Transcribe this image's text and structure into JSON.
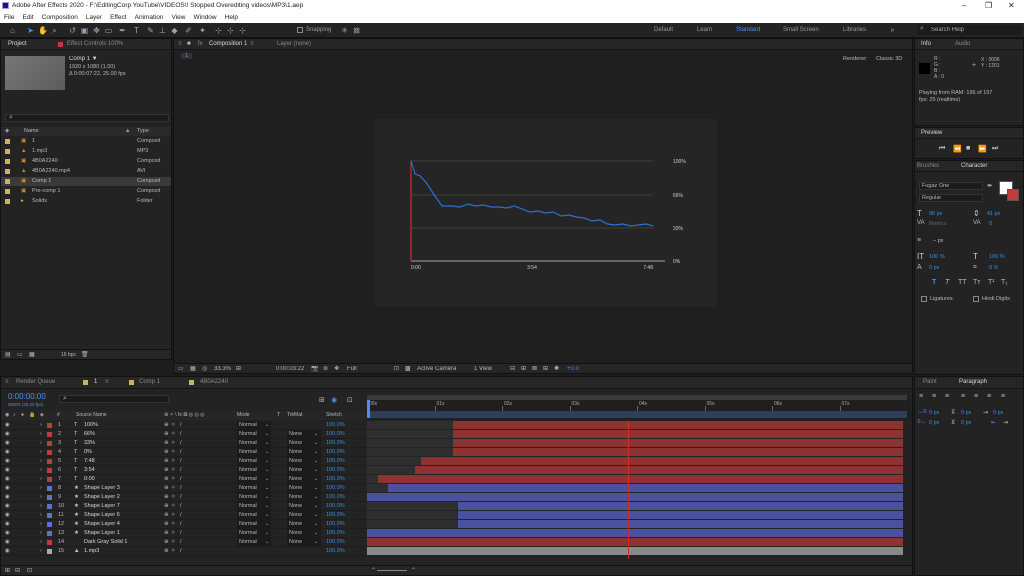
{
  "window": {
    "title": "Adobe After Effects 2020 - F:\\EditingCorp YouTube\\VIDEOS\\! Stopped Overediting videos\\MP3\\1.aep",
    "controls": [
      "–",
      "❐",
      "✕"
    ]
  },
  "menu": [
    "File",
    "Edit",
    "Composition",
    "Layer",
    "Effect",
    "Animation",
    "View",
    "Window",
    "Help"
  ],
  "toolbar": {
    "snapping": "Snapping",
    "workspaces": [
      "Default",
      "Learn",
      "Standard",
      "Small Screen",
      "Libraries"
    ],
    "active_workspace": "Standard",
    "search_help": "Search Help"
  },
  "project": {
    "tabs": [
      "Project",
      "Effect Controls 100%"
    ],
    "comp_name": "Comp 1 ▼",
    "comp_info": [
      "1920 x 1080 (1.00)",
      "Δ 0:00:07:22, 25.00 fps"
    ],
    "col_name": "Name",
    "col_type": "Type",
    "items": [
      {
        "name": "1",
        "type": "Composit",
        "color": "#c7b36b"
      },
      {
        "name": "1.mp3",
        "type": "MP3",
        "color": "#c7b36b"
      },
      {
        "name": "4B0A2240",
        "type": "Composit",
        "color": "#c7b36b"
      },
      {
        "name": "4B0A2240.mp4",
        "type": "AVI",
        "color": "#c7b36b"
      },
      {
        "name": "Comp 1",
        "type": "Composit",
        "color": "#c7b36b"
      },
      {
        "name": "Pre-comp 1",
        "type": "Composit",
        "color": "#c7b36b"
      },
      {
        "name": "Solids",
        "type": "Folder",
        "color": "#c7b36b"
      }
    ],
    "bpc": "16 bpc"
  },
  "composition": {
    "tabs": [
      "Composition 1",
      "Layer (none)"
    ],
    "sub_tab": "1",
    "renderer_label": "Renderer:",
    "renderer": "Classic 3D",
    "viewer": {
      "zoom": "33.3%",
      "time": "0:00:03:22",
      "resolution": "Full",
      "camera": "Active Camera",
      "view": "1 View",
      "exposure": "+0.0"
    }
  },
  "chart_data": {
    "type": "line",
    "x_tick_labels": [
      "0:00",
      "3:54",
      "7:48"
    ],
    "y_tick_labels": [
      "100%",
      "66%",
      "33%",
      "0%"
    ],
    "ylim": [
      0,
      100
    ],
    "xlim": [
      0,
      468
    ],
    "x": [
      0,
      8,
      18,
      30,
      45,
      60,
      80,
      95,
      110,
      125,
      140,
      155,
      170,
      185,
      200,
      215,
      230,
      245,
      260,
      275,
      290,
      305,
      320,
      335,
      350,
      365,
      380,
      395,
      410,
      425,
      440,
      455,
      468
    ],
    "values": [
      100,
      87,
      85,
      78,
      66,
      55,
      55,
      54,
      57,
      55,
      56,
      54,
      54,
      53,
      55,
      52,
      49,
      50,
      48,
      49,
      45,
      46,
      44,
      43,
      40,
      41,
      37,
      36,
      37,
      35,
      36,
      37,
      35
    ],
    "grid": true,
    "colors": {
      "line": "#2f6fd0",
      "axis": "#cc2b2b",
      "grid": "#4a4a4a"
    }
  },
  "info": {
    "tabs": [
      "Info",
      "Audio"
    ],
    "channels": [
      "R :",
      "G :",
      "B :",
      "A : 0"
    ],
    "coords": [
      "X : 3006",
      "Y : 1201"
    ],
    "status": [
      "Playing from RAM: 196 of 197",
      "fps: 25 (realtime)"
    ]
  },
  "preview": {
    "tab": "Preview"
  },
  "character": {
    "tabs": [
      "Brushes",
      "Character"
    ],
    "font": "Fugaz One",
    "style": "Regular",
    "size": "96 px",
    "leading": "41 px",
    "kerning": "Metrics",
    "tracking": "0",
    "stroke": "– px",
    "vscale": "100 %",
    "hscale": "100 %",
    "baseline": "0 px",
    "tsume": "0 %",
    "styles": [
      "T",
      "T",
      "TT",
      "Tᴛ",
      "T¹",
      "T₁"
    ],
    "ligatures": "Ligatures",
    "hindi": "Hindi Digits"
  },
  "paragraph": {
    "tabs": [
      "Paint",
      "Paragraph"
    ],
    "values": [
      "0 px",
      "0 px",
      "0 px",
      "0 px",
      "0 px"
    ]
  },
  "timeline": {
    "tabs": [
      "Render Queue",
      "1",
      "Comp 1",
      "4B0A2240"
    ],
    "timecode": "0:00:00:00",
    "timecode_sub": "00000 (25.00 fps)",
    "col_headers": [
      "#",
      "Source Name",
      "Mode",
      "T",
      "TrkMat",
      "Stretch"
    ],
    "ruler": [
      "00s",
      "01s",
      "02s",
      "03s",
      "04s",
      "05s",
      "06s",
      "07s"
    ],
    "layers": [
      {
        "num": "1",
        "type": "T",
        "name": "100%",
        "mode": "Normal",
        "trk": "",
        "stretch": "100.0%",
        "color": "#c23b3b",
        "bar_color": "#8f3232",
        "start": 0.16
      },
      {
        "num": "2",
        "type": "T",
        "name": "66%",
        "mode": "Normal",
        "trk": "None",
        "stretch": "100.0%",
        "color": "#c23b3b",
        "bar_color": "#8f3232",
        "start": 0.16
      },
      {
        "num": "3",
        "type": "T",
        "name": "33%",
        "mode": "Normal",
        "trk": "None",
        "stretch": "100.0%",
        "color": "#c23b3b",
        "bar_color": "#8f3232",
        "start": 0.16
      },
      {
        "num": "4",
        "type": "T",
        "name": "0%",
        "mode": "Normal",
        "trk": "None",
        "stretch": "100.0%",
        "color": "#c23b3b",
        "bar_color": "#8f3232",
        "start": 0.16
      },
      {
        "num": "5",
        "type": "T",
        "name": "7:48",
        "mode": "Normal",
        "trk": "None",
        "stretch": "100.0%",
        "color": "#c23b3b",
        "bar_color": "#8f3232",
        "start": 0.1
      },
      {
        "num": "6",
        "type": "T",
        "name": "3:54",
        "mode": "Normal",
        "trk": "None",
        "stretch": "100.0%",
        "color": "#c23b3b",
        "bar_color": "#8f3232",
        "start": 0.09
      },
      {
        "num": "7",
        "type": "T",
        "name": "0:00",
        "mode": "Normal",
        "trk": "None",
        "stretch": "100.0%",
        "color": "#c23b3b",
        "bar_color": "#8f3232",
        "start": 0.02
      },
      {
        "num": "8",
        "type": "★",
        "name": "Shape Layer 3",
        "mode": "Normal",
        "trk": "None",
        "stretch": "100.0%",
        "color": "#6070d0",
        "bar_color": "#4a52a0",
        "start": 0.04
      },
      {
        "num": "9",
        "type": "★",
        "name": "Shape Layer 2",
        "mode": "Normal",
        "trk": "None",
        "stretch": "100.0%",
        "color": "#6070d0",
        "bar_color": "#4a52a0",
        "start": 0.0
      },
      {
        "num": "10",
        "type": "★",
        "name": "Shape Layer 7",
        "mode": "Normal",
        "trk": "None",
        "stretch": "100.0%",
        "color": "#6070d0",
        "bar_color": "#4a52a0",
        "start": 0.17
      },
      {
        "num": "11",
        "type": "★",
        "name": "Shape Layer 6",
        "mode": "Normal",
        "trk": "None",
        "stretch": "100.0%",
        "color": "#6070d0",
        "bar_color": "#4a52a0",
        "start": 0.17
      },
      {
        "num": "12",
        "type": "★",
        "name": "Shape Layer 4",
        "mode": "Normal",
        "trk": "None",
        "stretch": "100.0%",
        "color": "#6070d0",
        "bar_color": "#4a52a0",
        "start": 0.17
      },
      {
        "num": "13",
        "type": "★",
        "name": "Shape Layer 1",
        "mode": "Normal",
        "trk": "None",
        "stretch": "100.0%",
        "color": "#6070d0",
        "bar_color": "#4a52a0",
        "start": 0.0
      },
      {
        "num": "14",
        "type": "",
        "name": "Dark Gray Solid 1",
        "mode": "Normal",
        "trk": "None",
        "stretch": "100.0%",
        "color": "#c23b3b",
        "bar_color": "#8f3232",
        "start": 0.0
      },
      {
        "num": "15",
        "type": "▲",
        "name": "1.mp3",
        "mode": "",
        "trk": "",
        "stretch": "100.0%",
        "color": "#a9a9a9",
        "bar_color": "#8a8a8a",
        "start": 0.0
      }
    ]
  }
}
